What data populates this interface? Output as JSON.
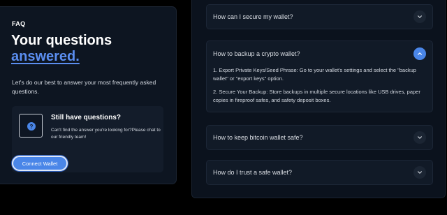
{
  "intro": {
    "eyebrow": "FAQ",
    "title_line1": "Your questions",
    "title_line2": "answered.",
    "subtitle": "Let's do our best to answer your most frequently asked questions."
  },
  "help_card": {
    "icon": "question-icon",
    "icon_glyph": "?",
    "title": "Still have questions?",
    "text": "Can't find the answer you're looking for?Please chat to our friendly team!",
    "button_label": "Connect Wallet"
  },
  "faq": {
    "items": [
      {
        "question": "How can I secure my wallet?",
        "expanded": false,
        "icon": "chevron-down-icon"
      },
      {
        "question": "How to backup a crypto wallet?",
        "expanded": true,
        "icon": "chevron-up-icon",
        "answers": [
          "1. Export Private Keys/Seed Phrase: Go to your wallet's settings and select the \"backup wallet\" or \"export keys\" option.",
          "2. Secure Your Backup: Store backups in multiple secure locations like USB drives, paper copies in fireproof safes, and safety deposit boxes."
        ]
      },
      {
        "question": "How to keep bitcoin wallet safe?",
        "expanded": false,
        "icon": "chevron-down-icon"
      },
      {
        "question": "How do I trust a safe wallet?",
        "expanded": false,
        "icon": "chevron-down-icon"
      }
    ]
  },
  "colors": {
    "accent": "#4a86e8",
    "title_accent": "#5b8ef0",
    "page_bg": "#000000",
    "card_bg": "#0d1521"
  }
}
